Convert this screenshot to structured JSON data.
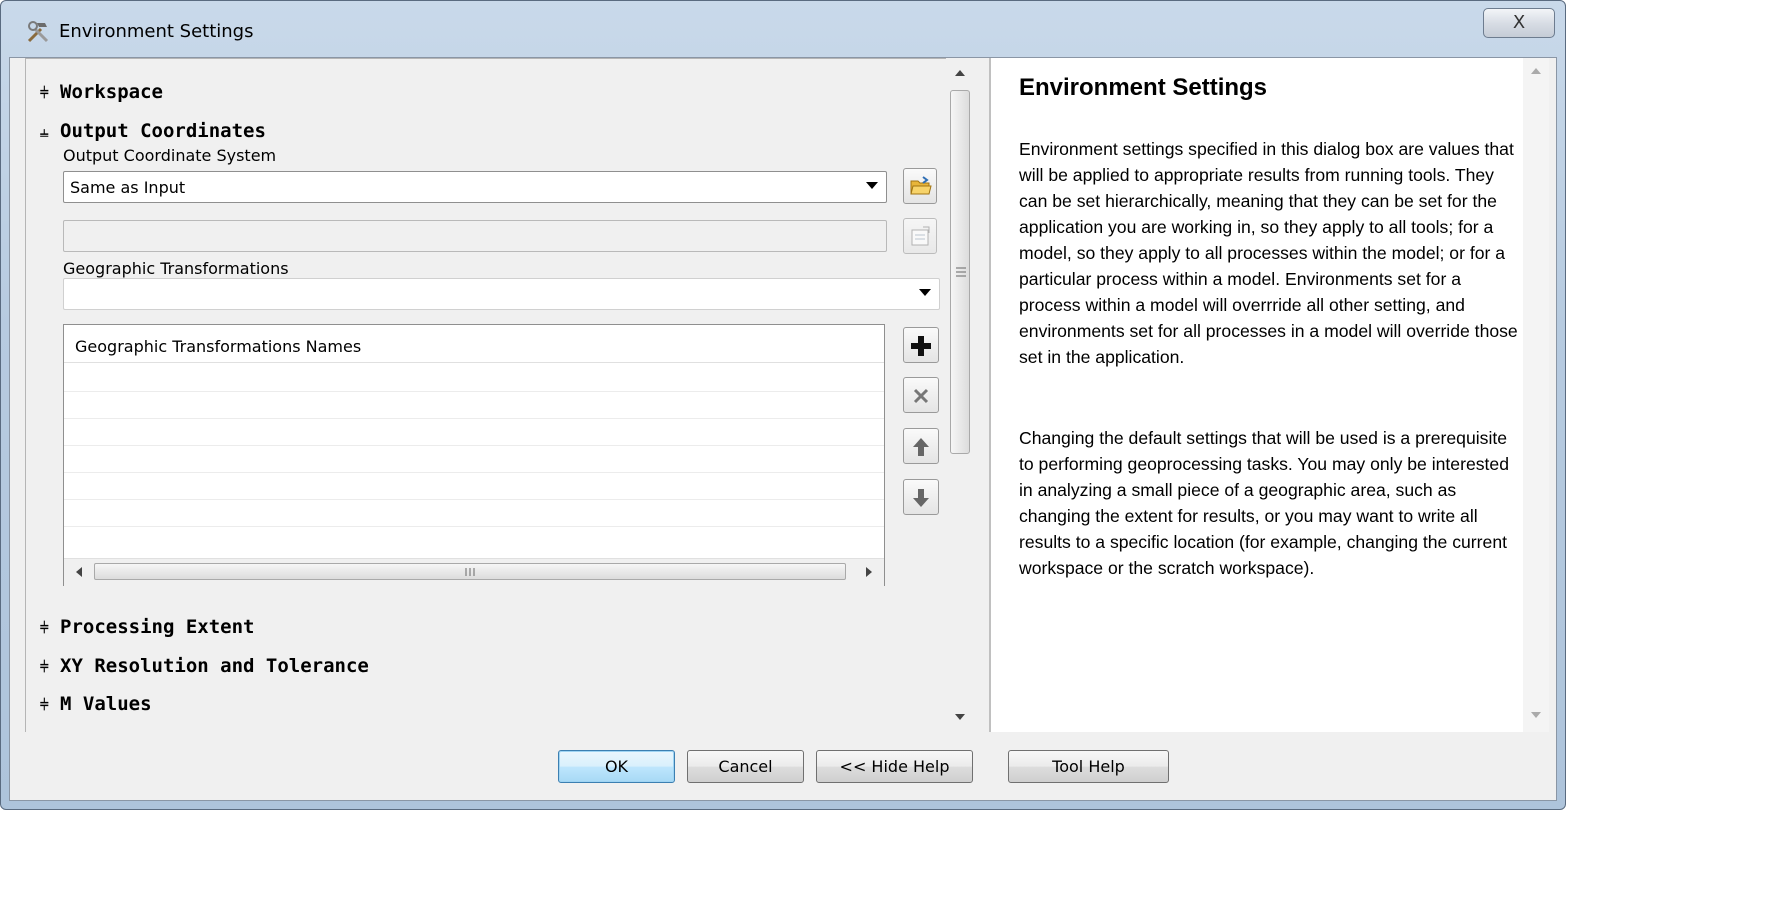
{
  "window": {
    "title": "Environment Settings",
    "close_glyph": "X"
  },
  "sections": {
    "workspace": "Workspace",
    "output_coordinates": "Output Coordinates",
    "processing_extent": "Processing Extent",
    "xy_resolution": "XY Resolution and Tolerance",
    "m_values": "M Values"
  },
  "output_coordinates": {
    "coordinate_system_label": "Output Coordinate System",
    "coordinate_system_value": "Same as Input",
    "coordinate_system_text": "",
    "geo_transformations_label": "Geographic Transformations",
    "geo_transformations_value": "",
    "grid_header": "Geographic Transformations Names",
    "grid_rows": []
  },
  "help": {
    "title": "Environment Settings",
    "paragraph1": "Environment settings specified in this dialog box are values that will be applied to appropriate results from running tools. They can be set hierarchically, meaning that they can be set for the application you are working in, so they apply to all tools; for a model, so they apply to all processes within the model; or for a particular process within a model. Environments set for a process within a model will overrride all other setting, and environments set for all processes in a model will override those set in the application.",
    "paragraph2": "Changing the default settings that will be used is a prerequisite to performing geoprocessing tasks. You may only be interested in analyzing a small piece of a geographic area, such as changing the extent for results, or you may want to write all results to a specific location (for example, changing the current workspace or the scratch workspace)."
  },
  "footer": {
    "ok": "OK",
    "cancel": "Cancel",
    "hide_help": "<< Hide Help",
    "tool_help": "Tool Help"
  },
  "icons": {
    "collapsed_chevron": "double-chevron-down",
    "expanded_chevron": "double-chevron-up",
    "app": "hammer-wrench-icon",
    "browse": "open-folder-icon",
    "properties": "properties-icon",
    "add": "plus-icon",
    "remove": "x-icon",
    "move_up": "arrow-up-icon",
    "move_down": "arrow-down-icon"
  },
  "colors": {
    "ok_button_accent": "#3c7fb1",
    "title_bar": "#b7cbe0"
  }
}
